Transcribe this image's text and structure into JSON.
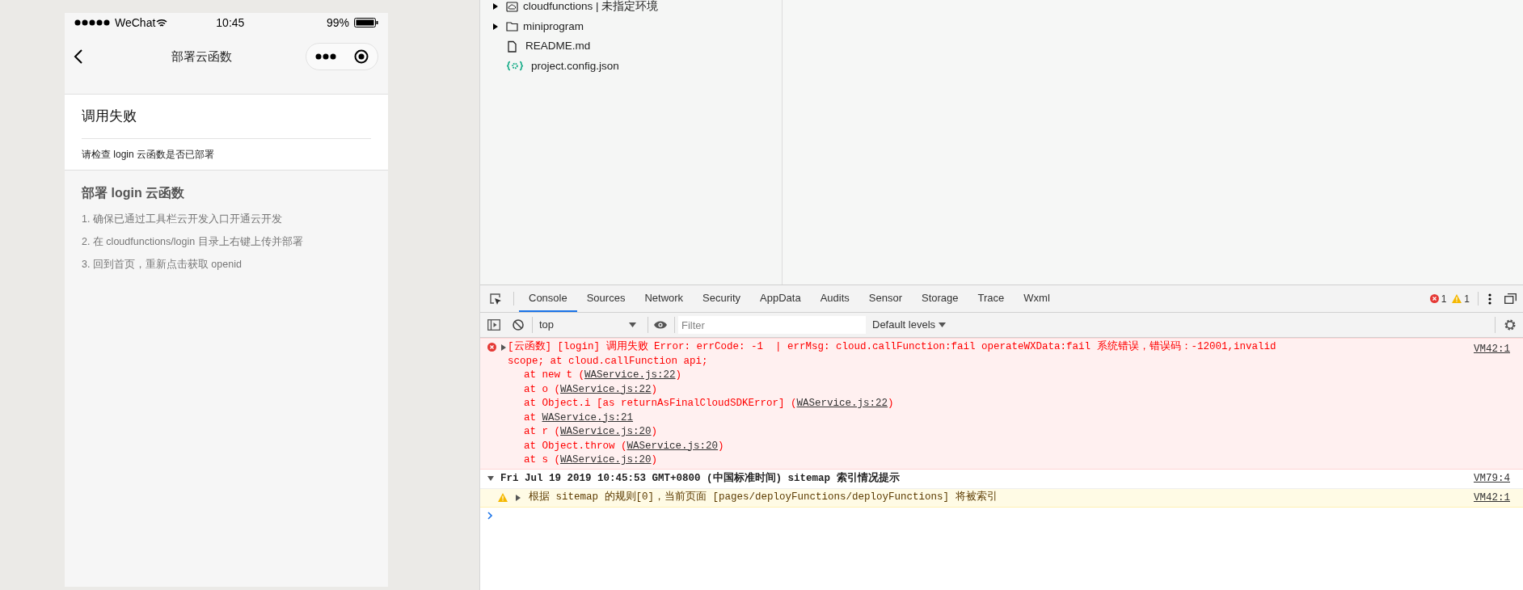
{
  "phone": {
    "status_bar": {
      "carrier": "WeChat",
      "time": "10:45",
      "battery": "99%"
    },
    "nav_bar": {
      "title": "部署云函数"
    },
    "result_card": {
      "title": "调用失败",
      "message": "请检查 login 云函数是否已部署"
    },
    "instructions": {
      "heading": "部署 login 云函数",
      "steps": [
        "1. 确保已通过工具栏云开发入口开通云开发",
        "2. 在 cloudfunctions/login 目录上右键上传并部署",
        "3. 回到首页，重新点击获取 openid"
      ]
    }
  },
  "file_tree": {
    "items": [
      {
        "name": "cloudfunctions | 未指定环境",
        "kind": "cloud-folder"
      },
      {
        "name": "miniprogram",
        "kind": "folder"
      },
      {
        "name": "README.md",
        "kind": "file"
      },
      {
        "name": "project.config.json",
        "kind": "config"
      }
    ]
  },
  "devtools": {
    "tabs": [
      {
        "label": "Console",
        "selected": true
      },
      {
        "label": "Sources",
        "selected": false
      },
      {
        "label": "Network",
        "selected": false
      },
      {
        "label": "Security",
        "selected": false
      },
      {
        "label": "AppData",
        "selected": false
      },
      {
        "label": "Audits",
        "selected": false
      },
      {
        "label": "Sensor",
        "selected": false
      },
      {
        "label": "Storage",
        "selected": false
      },
      {
        "label": "Trace",
        "selected": false
      },
      {
        "label": "Wxml",
        "selected": false
      }
    ],
    "error_count": "1",
    "warning_count": "1",
    "console_toolbar": {
      "context": "top",
      "filter_placeholder": "Filter",
      "levels": "Default levels"
    },
    "messages": [
      {
        "kind": "error",
        "text": "[云函数] [login] 调用失败 Error: errCode: -1  | errMsg: cloud.callFunction:fail operateWXData:fail 系统错误，错误码：-12001,invalid scope; at cloud.callFunction api;",
        "source": "VM42:1",
        "stack": [
          {
            "prefix": "at new t (",
            "link": "WAService.js:22",
            "suffix": ")"
          },
          {
            "prefix": "at o (",
            "link": "WAService.js:22",
            "suffix": ")"
          },
          {
            "prefix": "at Object.i [as returnAsFinalCloudSDKError] (",
            "link": "WAService.js:22",
            "suffix": ")"
          },
          {
            "prefix": "at ",
            "link": "WAService.js:21"
          },
          {
            "prefix": "at r (",
            "link": "WAService.js:20",
            "suffix": ")"
          },
          {
            "prefix": "at Object.throw (",
            "link": "WAService.js:20",
            "suffix": ")"
          },
          {
            "prefix": "at s (",
            "link": "WAService.js:20",
            "suffix": ")"
          }
        ]
      },
      {
        "kind": "group",
        "text": "Fri Jul 19 2019 10:45:53 GMT+0800 (中国标准时间) sitemap 索引情况提示",
        "source": "VM79:4"
      },
      {
        "kind": "warning",
        "text": "根据 sitemap 的规则[0]，当前页面 [pages/deployFunctions/deployFunctions] 将被索引",
        "source": "VM42:1"
      }
    ]
  }
}
